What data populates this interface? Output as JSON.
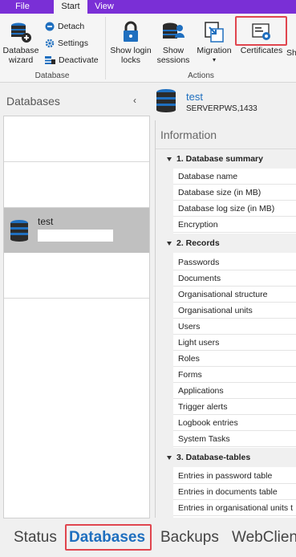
{
  "ribbon": {
    "tabs": [
      {
        "label": "File"
      },
      {
        "label": "Start"
      },
      {
        "label": "View"
      }
    ],
    "database_group": {
      "label": "Database",
      "wizard": "Database wizard",
      "detach": "Detach",
      "settings": "Settings",
      "deactivate": "Deactivate"
    },
    "actions_group": {
      "label": "Actions",
      "show_login_locks": "Show login locks",
      "show_sessions": "Show sessions",
      "migration": "Migration",
      "certificates": "Certificates",
      "overflow": "Sh"
    }
  },
  "left_panel": {
    "title": "Databases",
    "collapse_glyph": "‹",
    "selected_db": {
      "name": "test"
    }
  },
  "detail": {
    "db_name": "test",
    "server": "SERVERPWS,1433",
    "info_title": "Information",
    "categories": [
      {
        "title": "1. Database summary",
        "rows": [
          "Database name",
          "Database size (in MB)",
          "Database log size (in MB)",
          "Encryption"
        ]
      },
      {
        "title": "2. Records",
        "rows": [
          "Passwords",
          "Documents",
          "Organisational structure",
          "Organisational units",
          "Users",
          "Light users",
          "Roles",
          "Forms",
          "Applications",
          "Trigger alerts",
          "Logbook entries",
          "System Tasks"
        ]
      },
      {
        "title": "3. Database-tables",
        "rows": [
          "Entries in password table",
          "Entries in documents table",
          "Entries in organisational units t"
        ]
      }
    ]
  },
  "bottom_nav": {
    "items": [
      {
        "label": "Status"
      },
      {
        "label": "Databases"
      },
      {
        "label": "Backups"
      },
      {
        "label": "WebClien"
      }
    ]
  },
  "colors": {
    "tab_bar": "#7a2fd6",
    "accent_blue": "#1f6fbf",
    "highlight_red": "#e0454e",
    "selected_row": "#c0c0c0"
  }
}
